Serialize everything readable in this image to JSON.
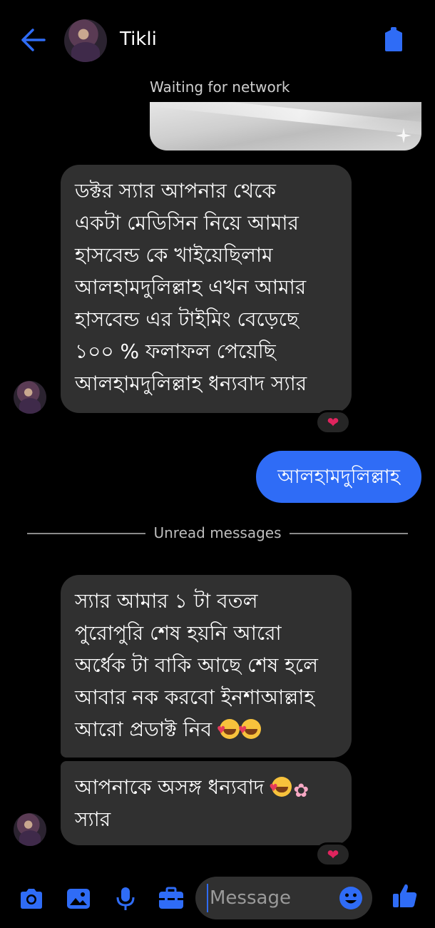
{
  "header": {
    "contact_name": "Tikli"
  },
  "chat": {
    "status": "Waiting for network",
    "messages": [
      {
        "lines": [
          "ডক্টর স্যার আপনার থেকে",
          "একটা মেডিসিন নিয়ে আমার",
          "হাসবেন্ড কে খাইয়েছিলাম",
          "আলহামদুলিল্লাহ এখন আমার",
          "হাসবেন্ড এর টাইমিং বেড়েছে",
          "১০০ % ফলাফল পেয়েছি",
          "আলহামদুলিল্লাহ ধন্যবাদ স্যার"
        ],
        "reaction": "❤"
      },
      {
        "text": "আলহামদুলিল্লাহ"
      },
      {
        "lines": [
          "স্যার আমার ১ টা বতল",
          "পুরোপুরি শেষ হয়নি আরো",
          "অর্ধেক টা বাকি আছে শেষ হলে",
          "আবার নক করবো ইনশাআল্লাহ",
          "আরো প্রডাক্ট নিব"
        ]
      },
      {
        "lines": [
          "আপনাকে অসঙ্গ ধন্যবাদ",
          "স্যার"
        ],
        "reaction": "❤"
      }
    ],
    "unread_divider": "Unread messages"
  },
  "composer": {
    "placeholder": "Message"
  },
  "colors": {
    "accent": "#2f6cf6",
    "incoming_bubble": "#303030",
    "background": "#000000"
  },
  "icons": [
    "back-arrow-icon",
    "shield-icon",
    "camera-icon",
    "gallery-icon",
    "microphone-icon",
    "toolbox-icon",
    "emoji-icon",
    "thumbs-up-icon"
  ]
}
